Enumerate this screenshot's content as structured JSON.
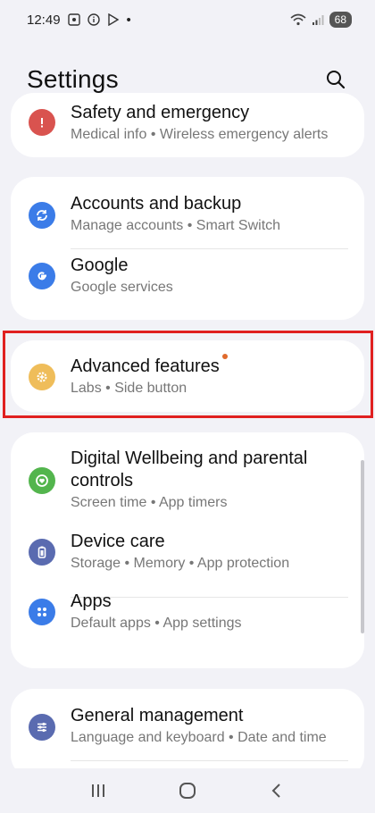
{
  "status_bar": {
    "time": "12:49",
    "dot": "•",
    "battery": "68"
  },
  "header": {
    "title": "Settings"
  },
  "items": {
    "safety": {
      "title": "Safety and emergency",
      "subtitle": "Medical info  •  Wireless emergency alerts",
      "icon": "alert-icon",
      "color": "#d9534f"
    },
    "accounts": {
      "title": "Accounts and backup",
      "subtitle": "Manage accounts  •  Smart Switch",
      "icon": "sync-icon",
      "color": "#3b7ce8"
    },
    "google": {
      "title": "Google",
      "subtitle": "Google services",
      "icon": "google-icon",
      "color": "#3b7ce8"
    },
    "advanced": {
      "title": "Advanced features",
      "subtitle": "Labs  •  Side button",
      "icon": "gear-plus-icon",
      "color": "#efbd5a"
    },
    "wellbeing": {
      "title": "Digital Wellbeing and parental controls",
      "title_line1": "Digital Wellbeing and parental",
      "title_line2": "controls",
      "subtitle": "Screen time  •  App timers",
      "icon": "heart-icon",
      "color": "#53b54d"
    },
    "device_care": {
      "title": "Device care",
      "subtitle": "Storage  •  Memory  •  App protection",
      "icon": "battery-icon",
      "color": "#5a6bb0"
    },
    "apps": {
      "title": "Apps",
      "subtitle": "Default apps  •  App settings",
      "icon": "apps-icon",
      "color": "#3b7ce8"
    },
    "general": {
      "title": "General management",
      "subtitle": "Language and keyboard  •  Date and time",
      "icon": "sliders-icon",
      "color": "#5a6bb0"
    }
  }
}
